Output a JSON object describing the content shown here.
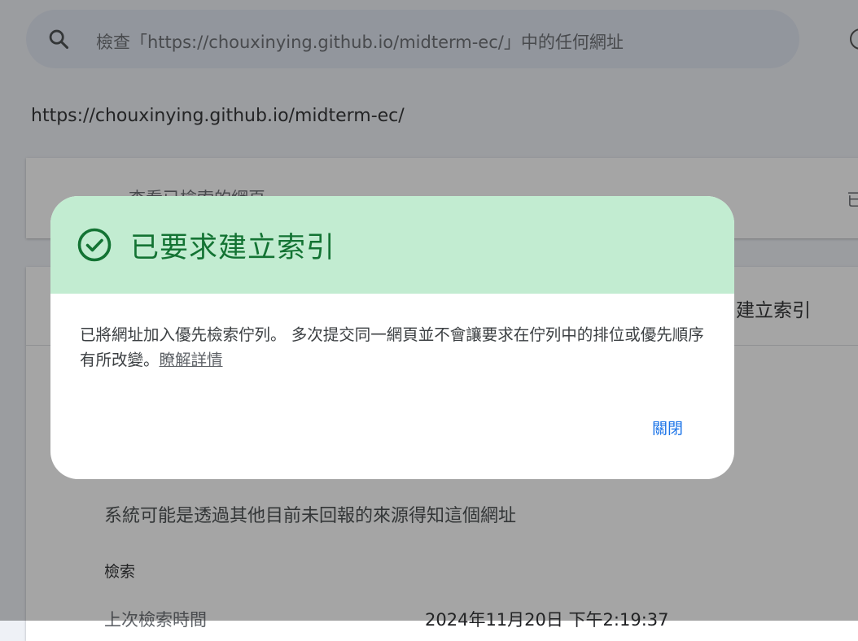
{
  "search": {
    "placeholder": "檢查「https://chouxinying.github.io/midterm-ec/」中的任何網址"
  },
  "page": {
    "url": "https://chouxinying.github.io/midterm-ec/"
  },
  "card1": {
    "view_crawled_label": "查看已檢索的網頁",
    "right_text": "已"
  },
  "card2": {
    "right_title": "建立索引",
    "source_desc": "系統可能是透過其他目前未回報的來源得知這個網址",
    "crawl_heading": "檢索",
    "last_crawl_label": "上次檢索時間",
    "last_crawl_value": "2024年11月20日 下午2:19:37"
  },
  "dialog": {
    "title": "已要求建立索引",
    "body_text": "已將網址加入優先檢索佇列。 多次提交同一網頁並不會讓要求在佇列中的排位或優先順序有所改變。",
    "learn_more_label": "瞭解詳情",
    "close_label": "關閉"
  },
  "colors": {
    "dialog_header_bg": "#c2ecd1",
    "success_green": "#137333",
    "link_blue": "#1a73e8"
  }
}
